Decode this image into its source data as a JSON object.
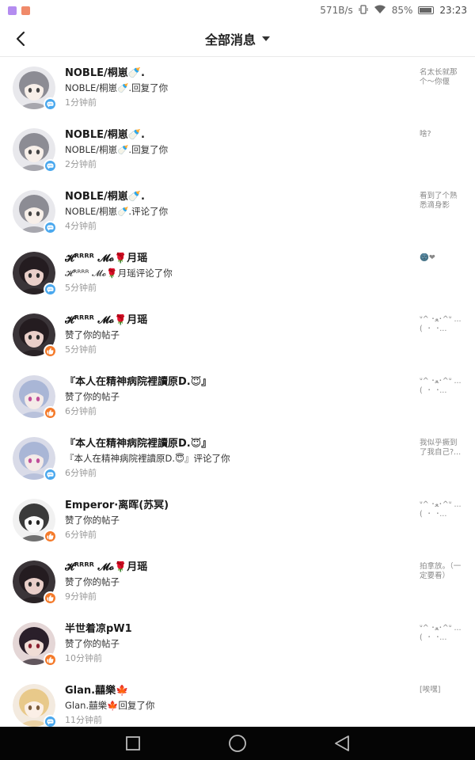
{
  "status_bar": {
    "speed": "571B/s",
    "battery": "85%",
    "time": "23:23",
    "app_icon_colors": [
      "#b48cf0",
      "#f08a6a"
    ]
  },
  "header": {
    "title": "全部消息"
  },
  "colors": {
    "comment_badge": "#4aa8ee",
    "like_badge": "#f47a2a"
  },
  "messages": [
    {
      "name": "NOBLE/桐崽🍼.",
      "action": "NOBLE/桐崽🍼.回复了你",
      "time": "1分钟前",
      "preview": "名太长就那个～你偃",
      "badge": "comment-icon",
      "avatar": "anime-girl-gray"
    },
    {
      "name": "NOBLE/桐崽🍼.",
      "action": "NOBLE/桐崽🍼.回复了你",
      "time": "2分钟前",
      "preview": "啥?",
      "badge": "comment-icon",
      "avatar": "anime-girl-gray"
    },
    {
      "name": "NOBLE/桐崽🍼.",
      "action": "NOBLE/桐崽🍼.评论了你",
      "time": "4分钟前",
      "preview": "看到了个熟悉滴身影",
      "badge": "comment-icon",
      "avatar": "anime-girl-gray"
    },
    {
      "name": "𝓗ᴿᴿᴿᴿ 𝓜𝓸🌹月瑶",
      "action": "𝓗ᴿᴿᴿᴿ 𝓜𝓸🌹月瑶评论了你",
      "time": "5分钟前",
      "preview": "🌚❤",
      "badge": "comment-icon",
      "avatar": "girl-photo"
    },
    {
      "name": "𝓗ᴿᴿᴿᴿ 𝓜𝓸🌹月瑶",
      "action": "赞了你的帖子",
      "time": "5分钟前",
      "preview": "ᐡ^ ･ﻌ･^ᐡ ... (  ･  ･...",
      "badge": "like-icon",
      "avatar": "girl-photo"
    },
    {
      "name": "『本人在精神病院裡讀原D.😇』",
      "action": "赞了你的帖子",
      "time": "6分钟前",
      "preview": "ᐡ^ ･ﻌ･^ᐡ ... (  ･  ･...",
      "badge": "like-icon",
      "avatar": "anime-boy-blue"
    },
    {
      "name": "『本人在精神病院裡讀原D.😇』",
      "action": "『本人在精神病院裡讀原D.😇』评论了你",
      "time": "6分钟前",
      "preview": "我似乎撅到了我自己?...",
      "badge": "comment-icon",
      "avatar": "anime-boy-blue"
    },
    {
      "name": "Emperor·离晖(苏冥)",
      "action": "赞了你的帖子",
      "time": "6分钟前",
      "preview": "ᐡ^ ･ﻌ･^ᐡ ... (  ･  ･...",
      "badge": "like-icon",
      "avatar": "anime-boy-sketch"
    },
    {
      "name": "𝓗ᴿᴿᴿᴿ 𝓜𝓸🌹月瑶",
      "action": "赞了你的帖子",
      "time": "9分钟前",
      "preview": "拍拿放。（一定要看）",
      "badge": "like-icon",
      "avatar": "girl-photo"
    },
    {
      "name": "半世着凉pW1",
      "action": "赞了你的帖子",
      "time": "10分钟前",
      "preview": "ᐡ^ ･ﻌ･^ᐡ ... (  ･  ･...",
      "badge": "like-icon",
      "avatar": "anime-boy-dark"
    },
    {
      "name": "Glan.囍樂🍁",
      "action": "Glan.囍樂🍁回复了你",
      "time": "11分钟前",
      "preview": "[唉嘿]",
      "badge": "comment-icon",
      "avatar": "anime-girl-blonde"
    }
  ]
}
